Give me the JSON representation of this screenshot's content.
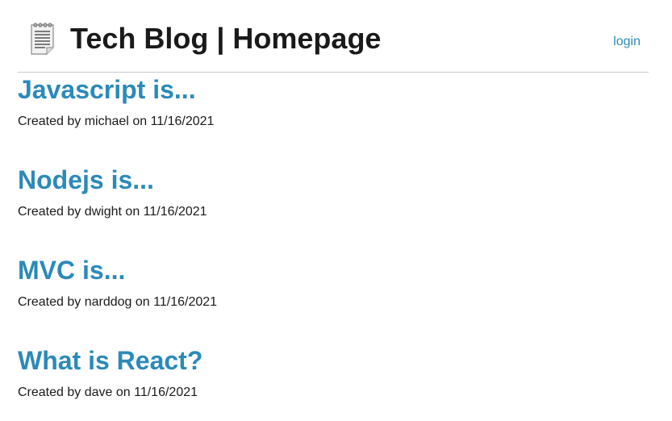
{
  "header": {
    "title": "Tech Blog | Homepage",
    "icon": "notepad-icon",
    "login_label": "login"
  },
  "posts": [
    {
      "title": "Javascript is...",
      "meta_prefix": "Created by",
      "author": "michael",
      "meta_on": "on",
      "date": "11/16/2021"
    },
    {
      "title": "Nodejs is...",
      "meta_prefix": "Created by",
      "author": "dwight",
      "meta_on": "on",
      "date": "11/16/2021"
    },
    {
      "title": "MVC is...",
      "meta_prefix": "Created by",
      "author": "narddog",
      "meta_on": "on",
      "date": "11/16/2021"
    },
    {
      "title": "What is React?",
      "meta_prefix": "Created by",
      "author": "dave",
      "meta_on": "on",
      "date": "11/16/2021"
    }
  ],
  "colors": {
    "link": "#2b8ab8",
    "text": "#1a1a1a",
    "divider": "#c8c8c8"
  }
}
